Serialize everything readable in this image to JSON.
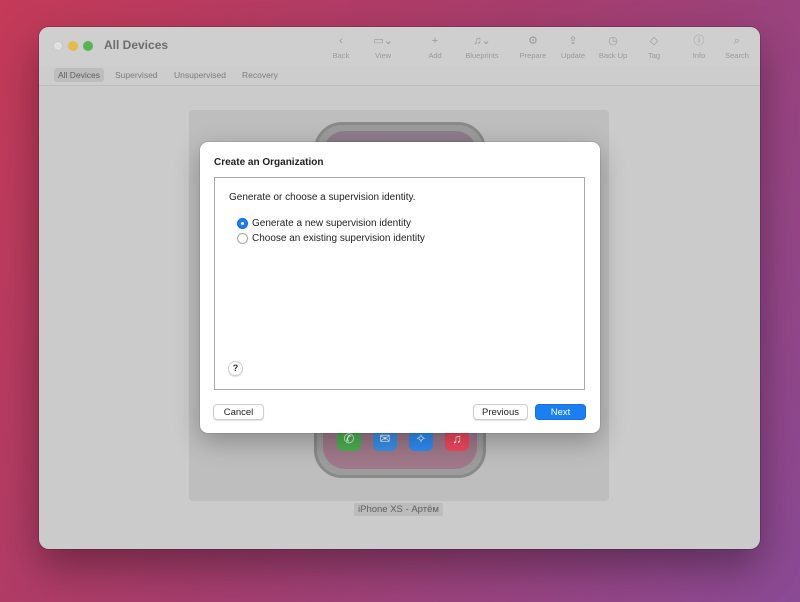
{
  "window": {
    "title": "All Devices",
    "toolbar": [
      {
        "icon": "chevron-left-icon",
        "glyph": "‹",
        "label": "Back"
      },
      {
        "icon": "view-icon",
        "glyph": "▭⌄",
        "label": "View"
      },
      {
        "icon": "add-icon",
        "glyph": "+",
        "label": "Add"
      },
      {
        "icon": "blueprints-icon",
        "glyph": "♫⌄",
        "label": "Blueprints"
      },
      {
        "icon": "prepare-icon",
        "glyph": "⚙",
        "label": "Prepare"
      },
      {
        "icon": "update-icon",
        "glyph": "⇪",
        "label": "Update"
      },
      {
        "icon": "backup-icon",
        "glyph": "◷",
        "label": "Back Up"
      },
      {
        "icon": "tag-icon",
        "glyph": "◇",
        "label": "Tag"
      },
      {
        "icon": "info-icon",
        "glyph": "ⓘ",
        "label": "Info"
      },
      {
        "icon": "search-icon",
        "glyph": "⌕",
        "label": "Search"
      }
    ],
    "tabs": [
      {
        "label": "All Devices",
        "active": true
      },
      {
        "label": "Supervised",
        "active": false
      },
      {
        "label": "Unsupervised",
        "active": false
      },
      {
        "label": "Recovery",
        "active": false
      }
    ],
    "device_name": "iPhone XS - Артём",
    "dock": [
      {
        "icon": "phone-icon",
        "glyph": "✆",
        "color": "#4caf50"
      },
      {
        "icon": "mail-icon",
        "glyph": "✉",
        "color": "#3b8fe6"
      },
      {
        "icon": "safari-icon",
        "glyph": "✧",
        "color": "#2f8cf0"
      },
      {
        "icon": "music-icon",
        "glyph": "♫",
        "color": "#f0475e"
      }
    ]
  },
  "dialog": {
    "title": "Create an Organization",
    "instruction": "Generate or choose a supervision identity.",
    "options": [
      {
        "label": "Generate a new supervision identity",
        "selected": true
      },
      {
        "label": "Choose an existing supervision identity",
        "selected": false
      }
    ],
    "help_label": "?",
    "cancel_label": "Cancel",
    "previous_label": "Previous",
    "next_label": "Next"
  }
}
